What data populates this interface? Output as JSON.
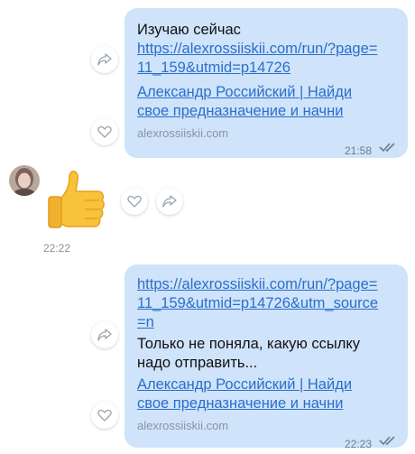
{
  "messages": [
    {
      "lines": [
        "Изучаю сейчас"
      ],
      "link_lines": [
        "https://alexrossiiskii.com/run/?page=",
        "11_159&utmid=p14726"
      ],
      "preview_title_lines": [
        "Александр Российский | Найди",
        "свое предназначение и начни"
      ],
      "preview_domain": "alexrossiiskii.com",
      "time": "21:58"
    },
    {
      "sticker": "thumbs-up",
      "time": "22:22"
    },
    {
      "link_lines": [
        "https://alexrossiiskii.com/run/?page=",
        "11_159&utmid=p14726&utm_source",
        "=n"
      ],
      "lines": [
        "Только не поняла, какую ссылку",
        "надо отправить..."
      ],
      "preview_title_lines": [
        "Александр Российский | Найди",
        "свое предназначение и начни"
      ],
      "preview_domain": "alexrossiiskii.com",
      "time": "22:23"
    }
  ],
  "icons": {
    "share": "share-icon",
    "like": "heart-icon",
    "read": "double-check-icon"
  },
  "colors": {
    "bubble": "#cfe3fb",
    "link": "#2a6fc9"
  }
}
